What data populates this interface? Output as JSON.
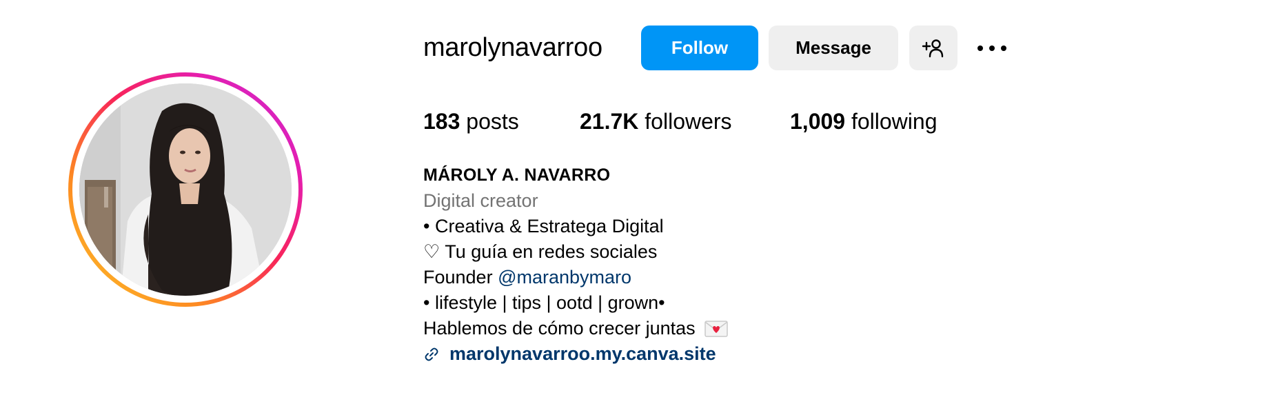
{
  "profile": {
    "username": "marolynavarroo",
    "avatar_alt": "profile picture"
  },
  "actions": {
    "follow_label": "Follow",
    "message_label": "Message",
    "suggest_icon": "add-person-icon",
    "more_icon": "more-options-icon"
  },
  "stats": {
    "posts_count": "183",
    "posts_label": "posts",
    "followers_count": "21.7K",
    "followers_label": "followers",
    "following_count": "1,009",
    "following_label": "following"
  },
  "bio": {
    "full_name": "MÁROLY A. NAVARRO",
    "category": "Digital creator",
    "line1": "• Creativa & Estratega Digital",
    "line2": "♡ Tu guía en redes sociales",
    "line3_prefix": "Founder ",
    "line3_mention": "@maranbymaro",
    "line4": "• lifestyle | tips | ootd | grown•",
    "line5": "Hablemos de cómo crecer juntas",
    "line5_emoji": "love-letter-icon",
    "link_icon": "link-icon",
    "link": "marolynavarroo.my.canva.site"
  },
  "colors": {
    "follow_bg": "#0095f6",
    "secondary_btn_bg": "#efefef",
    "link_color": "#00376b",
    "category_color": "#737373",
    "ring_gradient": [
      "#fdc72b",
      "#fd8a22",
      "#f8245a",
      "#e51eaf",
      "#c32bd9"
    ]
  }
}
